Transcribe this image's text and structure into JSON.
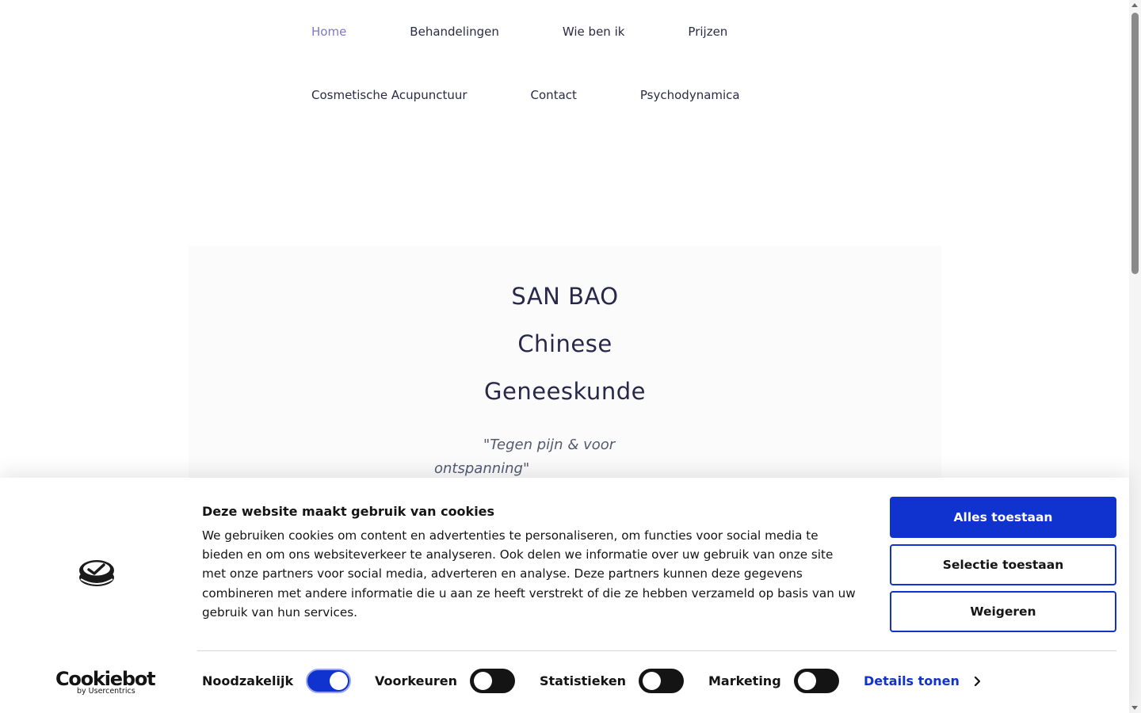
{
  "nav": {
    "row1": [
      {
        "label": "Home",
        "active": true
      },
      {
        "label": "Behandelingen"
      },
      {
        "label": "Wie ben ik"
      },
      {
        "label": "Prijzen"
      }
    ],
    "row2": [
      {
        "label": "Cosmetische Acupunctuur"
      },
      {
        "label": "Contact"
      },
      {
        "label": "Psychodynamica"
      }
    ]
  },
  "hero": {
    "line1": "SAN BAO",
    "line2": "Chinese",
    "line3": "Geneeskunde",
    "tagline": "\"Tegen pijn & voor ontspanning\""
  },
  "cookie": {
    "heading": "Deze website maakt gebruik van cookies",
    "body": "We gebruiken cookies om content en advertenties te personaliseren, om functies voor social media te bieden en om ons websiteverkeer te analyseren. Ook delen we informatie over uw gebruik van onze site met onze partners voor social media, adverteren en analyse. Deze partners kunnen deze gegevens combineren met andere informatie die u aan ze heeft verstrekt of die ze hebben verzameld op basis van uw gebruik van hun services.",
    "buttons": {
      "allow_all": "Alles toestaan",
      "allow_selection": "Selectie toestaan",
      "deny": "Weigeren"
    },
    "toggles": {
      "necessary": {
        "label": "Noodzakelijk",
        "on": true
      },
      "preferences": {
        "label": "Voorkeuren",
        "on": false
      },
      "statistics": {
        "label": "Statistieken",
        "on": false
      },
      "marketing": {
        "label": "Marketing",
        "on": false
      }
    },
    "details_label": "Details tonen",
    "brand_name": "Cookiebot",
    "brand_sub": "by Usercentrics",
    "colors": {
      "primary": "#1032cf",
      "text": "#141414"
    }
  },
  "icons": {
    "cookie_logo": "cookiebot-logo-icon",
    "details_chevron": "chevron-right-icon"
  }
}
